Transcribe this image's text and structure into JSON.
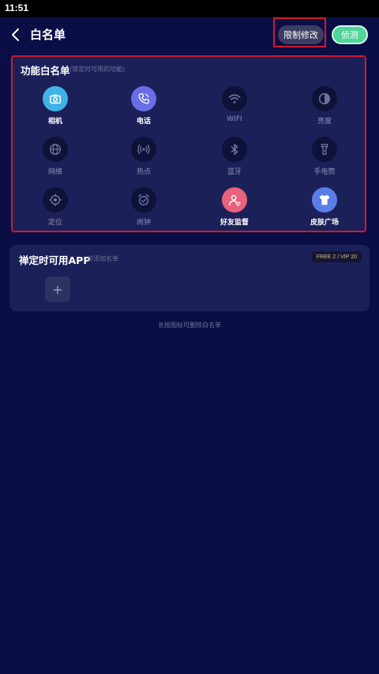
{
  "status_bar": {
    "time": "11:51"
  },
  "nav": {
    "title": "白名单",
    "limit_button": "限制修改",
    "detect_button": "侦测"
  },
  "function_whitelist": {
    "title": "功能白名单",
    "subtitle": "(锁定时可用的功能)",
    "items": [
      {
        "label": "相机",
        "icon": "camera-icon",
        "active": true,
        "color": "#3fb3e8"
      },
      {
        "label": "电话",
        "icon": "phone-icon",
        "active": true,
        "color": "#6a6de6"
      },
      {
        "label": "WIFI",
        "icon": "wifi-icon",
        "active": false
      },
      {
        "label": "亮度",
        "icon": "brightness-icon",
        "active": false
      },
      {
        "label": "网络",
        "icon": "globe-icon",
        "active": false
      },
      {
        "label": "热点",
        "icon": "hotspot-icon",
        "active": false
      },
      {
        "label": "蓝牙",
        "icon": "bluetooth-icon",
        "active": false
      },
      {
        "label": "手电筒",
        "icon": "flashlight-icon",
        "active": false
      },
      {
        "label": "定位",
        "icon": "location-icon",
        "active": false
      },
      {
        "label": "闹钟",
        "icon": "alarm-icon",
        "active": false
      },
      {
        "label": "好友监督",
        "icon": "friend-supervise-icon",
        "active": true,
        "color": "#e8617d"
      },
      {
        "label": "皮肤广场",
        "icon": "shirt-icon",
        "active": true,
        "color": "#5b7de8"
      }
    ]
  },
  "app_whitelist": {
    "title": "禅定时可用APP",
    "subtitle": "可添加名单",
    "badge": "FREE 2 / VIP 20",
    "add_label": "+"
  },
  "hint": "长按图标可删除白名单"
}
